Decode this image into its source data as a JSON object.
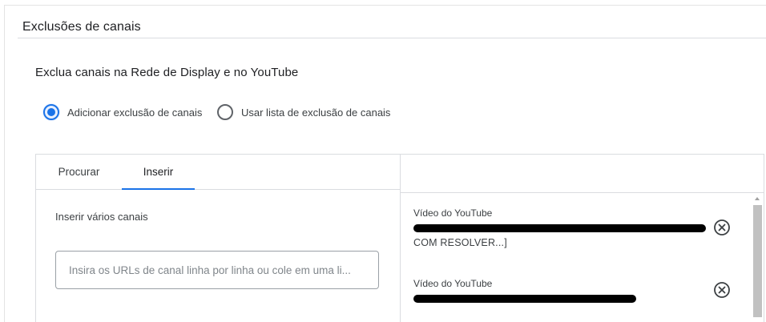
{
  "section": {
    "title": "Exclusões de canais"
  },
  "subheading": "Exclua canais na Rede de Display e no YouTube",
  "radio_options": [
    {
      "label": "Adicionar exclusão de canais",
      "checked": true
    },
    {
      "label": "Usar lista de exclusão de canais",
      "checked": false
    }
  ],
  "tabs": [
    {
      "label": "Procurar",
      "active": false
    },
    {
      "label": "Inserir",
      "active": true
    }
  ],
  "insert": {
    "label": "Inserir vários canais",
    "placeholder": "Insira os URLs de canal linha por linha ou cole em uma li...",
    "value": ""
  },
  "excluded_items": [
    {
      "type": "Vídeo do YouTube",
      "title_tail": "COM RESOLVER...]",
      "redacted": true
    },
    {
      "type": "Vídeo do YouTube",
      "title_tail": "",
      "redacted": true
    }
  ],
  "icons": {
    "remove": "circle-x-icon",
    "scroll_up": "scroll-up-arrow-icon"
  },
  "colors": {
    "accent": "#1a73e8",
    "text": "#202124",
    "border": "#dadce0"
  }
}
